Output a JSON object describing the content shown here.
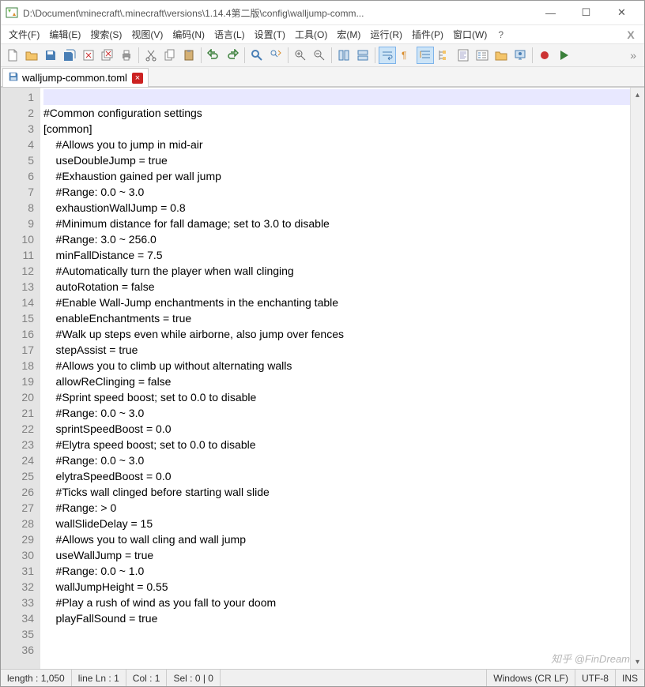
{
  "window": {
    "path": "D:\\Document\\minecraft\\.minecraft\\versions\\1.14.4第二版\\config\\walljump-comm...",
    "min": "—",
    "max": "☐",
    "close": "✕"
  },
  "menu": {
    "items": [
      "文件(F)",
      "编辑(E)",
      "搜索(S)",
      "视图(V)",
      "编码(N)",
      "语言(L)",
      "设置(T)",
      "工具(O)",
      "宏(M)",
      "运行(R)",
      "插件(P)",
      "窗口(W)"
    ],
    "help": "?",
    "x": "X"
  },
  "tab": {
    "filename": "walljump-common.toml",
    "close": "×"
  },
  "lines": [
    "",
    "#Common configuration settings",
    "[common]",
    "    #Allows you to jump in mid-air",
    "    useDoubleJump = true",
    "    #Exhaustion gained per wall jump",
    "    #Range: 0.0 ~ 3.0",
    "    exhaustionWallJump = 0.8",
    "    #Minimum distance for fall damage; set to 3.0 to disable",
    "    #Range: 3.0 ~ 256.0",
    "    minFallDistance = 7.5",
    "    #Automatically turn the player when wall clinging",
    "    autoRotation = false",
    "    #Enable Wall-Jump enchantments in the enchanting table",
    "    enableEnchantments = true",
    "    #Walk up steps even while airborne, also jump over fences",
    "    stepAssist = true",
    "    #Allows you to climb up without alternating walls",
    "    allowReClinging = false",
    "    #Sprint speed boost; set to 0.0 to disable",
    "    #Range: 0.0 ~ 3.0",
    "    sprintSpeedBoost = 0.0",
    "    #Elytra speed boost; set to 0.0 to disable",
    "    #Range: 0.0 ~ 3.0",
    "    elytraSpeedBoost = 0.0",
    "    #Ticks wall clinged before starting wall slide",
    "    #Range: > 0",
    "    wallSlideDelay = 15",
    "    #Allows you to wall cling and wall jump",
    "    useWallJump = true",
    "    #Range: 0.0 ~ 1.0",
    "    wallJumpHeight = 0.55",
    "    #Play a rush of wind as you fall to your doom",
    "    playFallSound = true",
    "",
    ""
  ],
  "status": {
    "length": "length : 1,050",
    "line": "line Ln : 1",
    "col": "Col : 1",
    "sel": "Sel : 0 | 0",
    "eol": "Windows (CR LF)",
    "enc": "UTF-8",
    "ins": "INS"
  },
  "watermark": "知乎 @FinDream",
  "toolbar_icons": [
    "new-file-icon",
    "open-file-icon",
    "save-icon",
    "save-all-icon",
    "close-icon",
    "close-all-icon",
    "print-icon",
    "sep",
    "cut-icon",
    "copy-icon",
    "paste-icon",
    "sep",
    "undo-icon",
    "redo-icon",
    "sep",
    "find-icon",
    "replace-icon",
    "sep",
    "zoom-in-icon",
    "zoom-out-icon",
    "sep",
    "sync-v-icon",
    "sync-h-icon",
    "sep",
    "wordwrap-icon",
    "show-all-icon",
    "indent-guide-icon",
    "folder-tree-icon",
    "doc-map-icon",
    "func-list-icon",
    "folder-icon",
    "monitor-icon",
    "sep",
    "record-icon",
    "play-icon"
  ]
}
